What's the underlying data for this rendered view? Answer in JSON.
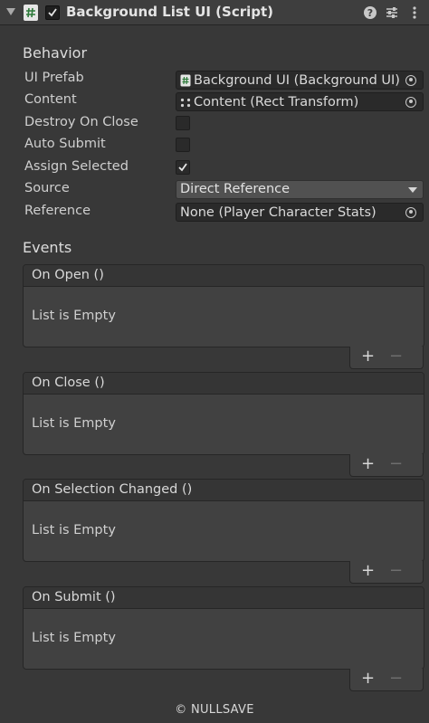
{
  "header": {
    "title": "Background List UI (Script)",
    "icons": [
      "foldout-arrow-icon",
      "script-icon",
      "enable-checkbox-icon",
      "help-icon",
      "presets-icon",
      "more-menu-icon"
    ]
  },
  "behavior": {
    "title": "Behavior",
    "ui_prefab": {
      "label": "UI Prefab",
      "value": "Background UI (Background UI)"
    },
    "content": {
      "label": "Content",
      "value": "Content (Rect Transform)"
    },
    "destroy_on_close": {
      "label": "Destroy On Close",
      "checked": false
    },
    "auto_submit": {
      "label": "Auto Submit",
      "checked": false
    },
    "assign_selected": {
      "label": "Assign Selected",
      "checked": true
    },
    "source": {
      "label": "Source",
      "value": "Direct Reference"
    },
    "reference": {
      "label": "Reference",
      "value": "None (Player Character Stats)"
    }
  },
  "events": {
    "title": "Events",
    "items": [
      {
        "name": "On Open ()",
        "empty_text": "List is Empty",
        "plus": "+",
        "minus": "−"
      },
      {
        "name": "On Close ()",
        "empty_text": "List is Empty",
        "plus": "+",
        "minus": "−"
      },
      {
        "name": "On Selection Changed ()",
        "empty_text": "List is Empty",
        "plus": "+",
        "minus": "−"
      },
      {
        "name": "On Submit ()",
        "empty_text": "List is Empty",
        "plus": "+",
        "minus": "−"
      }
    ]
  },
  "footer": {
    "text": "© NULLSAVE"
  }
}
